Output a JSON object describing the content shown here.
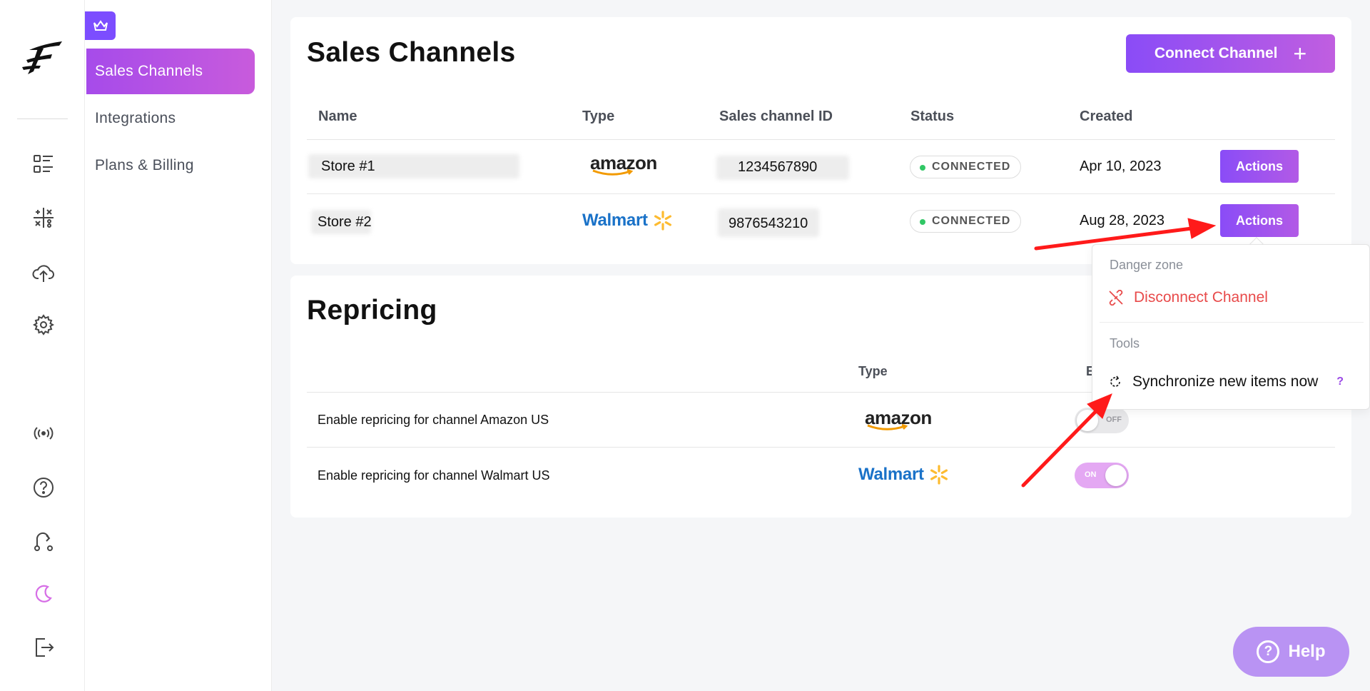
{
  "rail": {
    "icons": [
      "list-icon",
      "calculator-icon",
      "cloud-upload-icon",
      "gear-icon",
      "broadcast-icon",
      "question-icon",
      "route-icon",
      "moon-icon",
      "logout-icon"
    ]
  },
  "subnav": {
    "items": [
      {
        "label": "Sales Channels",
        "active": true
      },
      {
        "label": "Integrations",
        "active": false
      },
      {
        "label": "Plans & Billing",
        "active": false
      }
    ]
  },
  "sales_channels": {
    "title": "Sales Channels",
    "connect_label": "Connect Channel",
    "columns": [
      "Name",
      "Type",
      "Sales channel ID",
      "Status",
      "Created"
    ],
    "rows": [
      {
        "name": "Store #1",
        "type": "amazon",
        "channel_id": "1234567890",
        "status": "CONNECTED",
        "created": "Apr 10, 2023",
        "action": "Actions"
      },
      {
        "name": "Store #2",
        "type": "Walmart",
        "channel_id": "9876543210",
        "status": "CONNECTED",
        "created": "Aug 28, 2023",
        "action": "Actions"
      }
    ]
  },
  "dropdown": {
    "danger_header": "Danger zone",
    "disconnect_label": "Disconnect Channel",
    "tools_header": "Tools",
    "sync_label": "Synchronize new items now",
    "sync_help": "?"
  },
  "repricing": {
    "title": "Repricing",
    "type_header": "Type",
    "enabled_header_partial": "E",
    "rows": [
      {
        "label": "Enable repricing for channel Amazon US",
        "type": "amazon",
        "toggle": "OFF",
        "enabled": false
      },
      {
        "label": "Enable repricing for channel Walmart US",
        "type": "Walmart",
        "toggle": "ON",
        "enabled": true
      }
    ]
  },
  "help": {
    "label": "Help"
  },
  "colors": {
    "accent": "#8a4cf7",
    "accent2": "#c05ee0",
    "danger": "#e84a4a",
    "connected": "#31c765",
    "annotation": "#ff0000"
  }
}
